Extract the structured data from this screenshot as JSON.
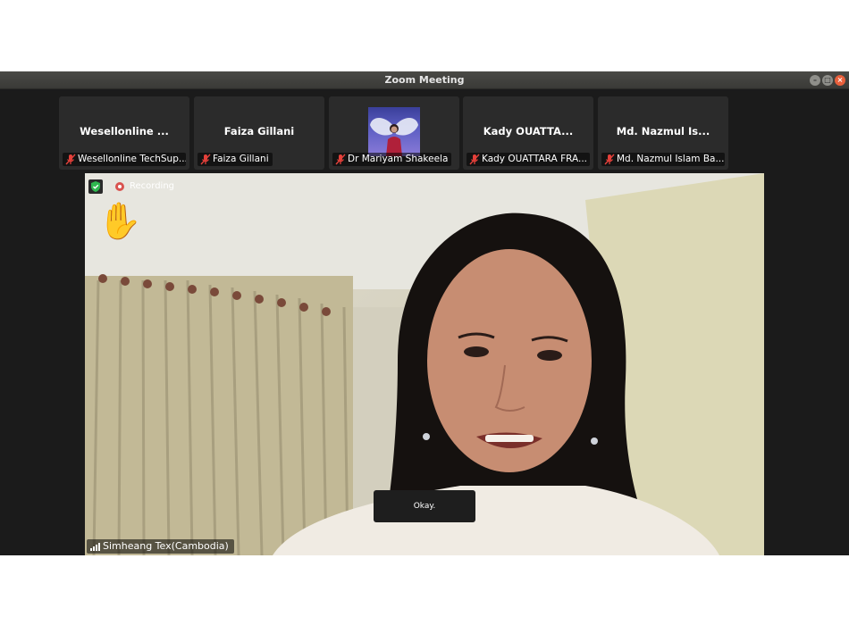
{
  "window": {
    "title": "Zoom Meeting"
  },
  "participants": [
    {
      "tile_name": "Wesellonline ...",
      "label": "Wesellonline TechSup...",
      "has_video": false
    },
    {
      "tile_name": "Faiza Gillani",
      "label": "Faiza Gillani",
      "has_video": false
    },
    {
      "tile_name": "",
      "label": "Dr Mariyam Shakeela",
      "has_video": true
    },
    {
      "tile_name": "Kady OUATTA...",
      "label": "Kady OUATTARA FRA...",
      "has_video": false
    },
    {
      "tile_name": "Md. Nazmul Is...",
      "label": "Md. Nazmul Islam Ba...",
      "has_video": false
    }
  ],
  "main_video": {
    "recording_label": "Recording",
    "caption": "Okay.",
    "speaker_name": "Simheang Tex(Cambodia)",
    "raised_hand_icon": "raised-hand-icon"
  },
  "colors": {
    "mute_red": "#e5403a",
    "recording_red": "#d9534f",
    "shield_green": "#2fb84f",
    "close_orange": "#e9603c"
  }
}
